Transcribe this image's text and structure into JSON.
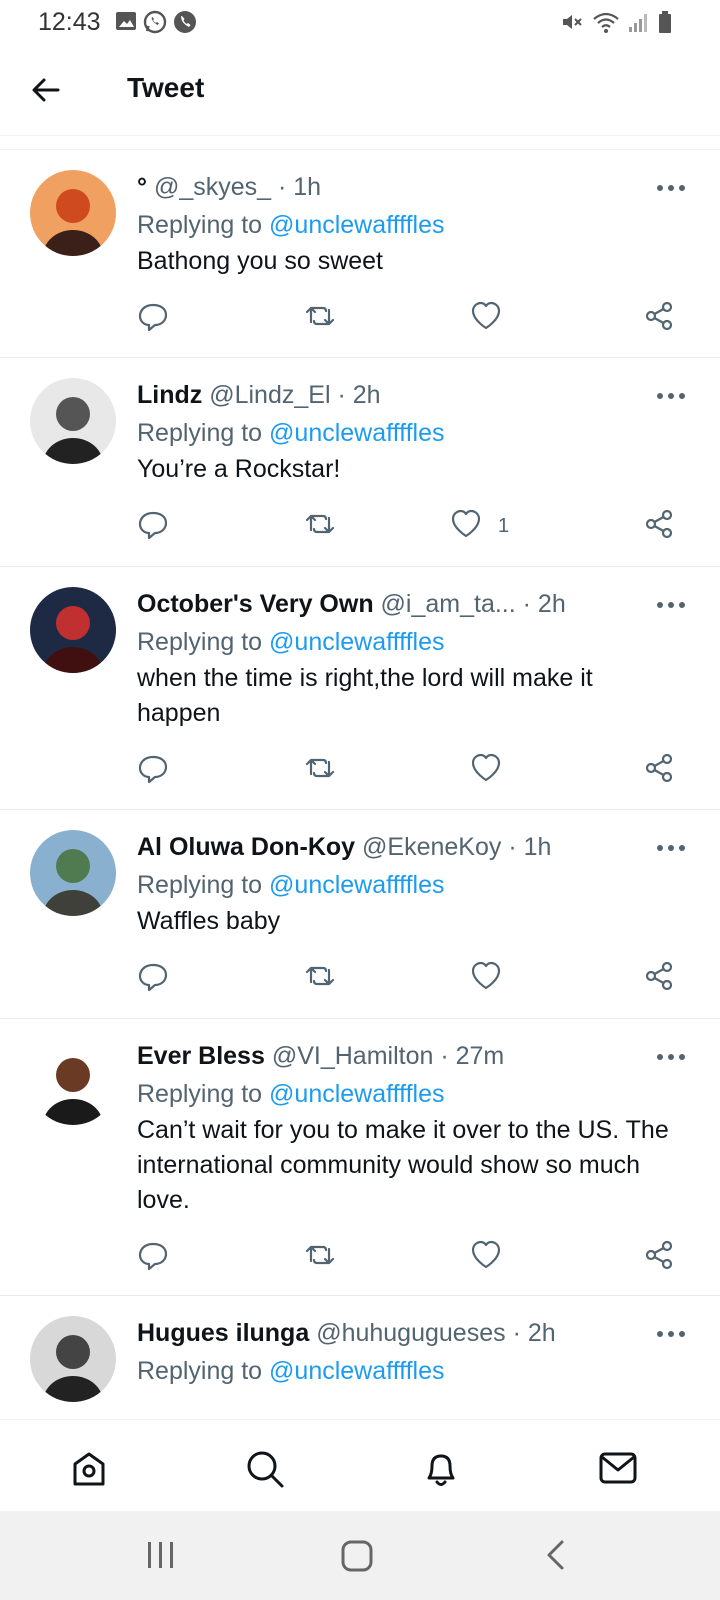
{
  "status_bar": {
    "time": "12:43",
    "left_icons": [
      "image-icon",
      "whatsapp-icon",
      "phone-icon"
    ],
    "right_icons": [
      "mute-icon",
      "wifi-icon",
      "signal-icon",
      "battery-icon"
    ]
  },
  "header": {
    "title": "Tweet",
    "back_icon": "back-arrow-icon"
  },
  "replying_prefix": "Replying to",
  "colors": {
    "accent": "#1d9bf0",
    "secondary_text": "#536471",
    "primary_text": "#0f1419"
  },
  "tweets": [
    {
      "name": "°",
      "handle": "@_skyes_",
      "time": "· 1h",
      "replying_to": "@unclewaffffles",
      "text": "Bathong you so sweet",
      "likes": ""
    },
    {
      "name": "Lindz",
      "handle": "@Lindz_El",
      "time": "· 2h",
      "replying_to": "@unclewaffffles",
      "text": "You’re a Rockstar!",
      "likes": "1"
    },
    {
      "name": "October's Very Own",
      "handle": "@i_am_ta...",
      "time": "· 2h",
      "replying_to": "@unclewaffffles",
      "text": "when the time is right,the lord will make it happen",
      "likes": ""
    },
    {
      "name": "Al Oluwa Don-Koy",
      "handle": "@EkeneKoy",
      "time": "· 1h",
      "replying_to": "@unclewaffffles",
      "text": "Waffles baby",
      "likes": ""
    },
    {
      "name": "Ever Bless",
      "handle": "@VI_Hamilton",
      "time": "· 27m",
      "replying_to": "@unclewaffffles",
      "text": "Can’t wait for you to make it over to the US. The international community would show so much love.",
      "likes": ""
    },
    {
      "name": "Hugues ilunga",
      "handle": "@huhugugueses",
      "time": "· 2h",
      "replying_to": "@unclewaffffles",
      "text": "",
      "likes": ""
    }
  ],
  "bottom_nav": [
    "home-icon",
    "search-icon",
    "notifications-icon",
    "messages-icon"
  ],
  "system_nav": [
    "recent-apps-icon",
    "home-button-icon",
    "back-nav-icon"
  ]
}
